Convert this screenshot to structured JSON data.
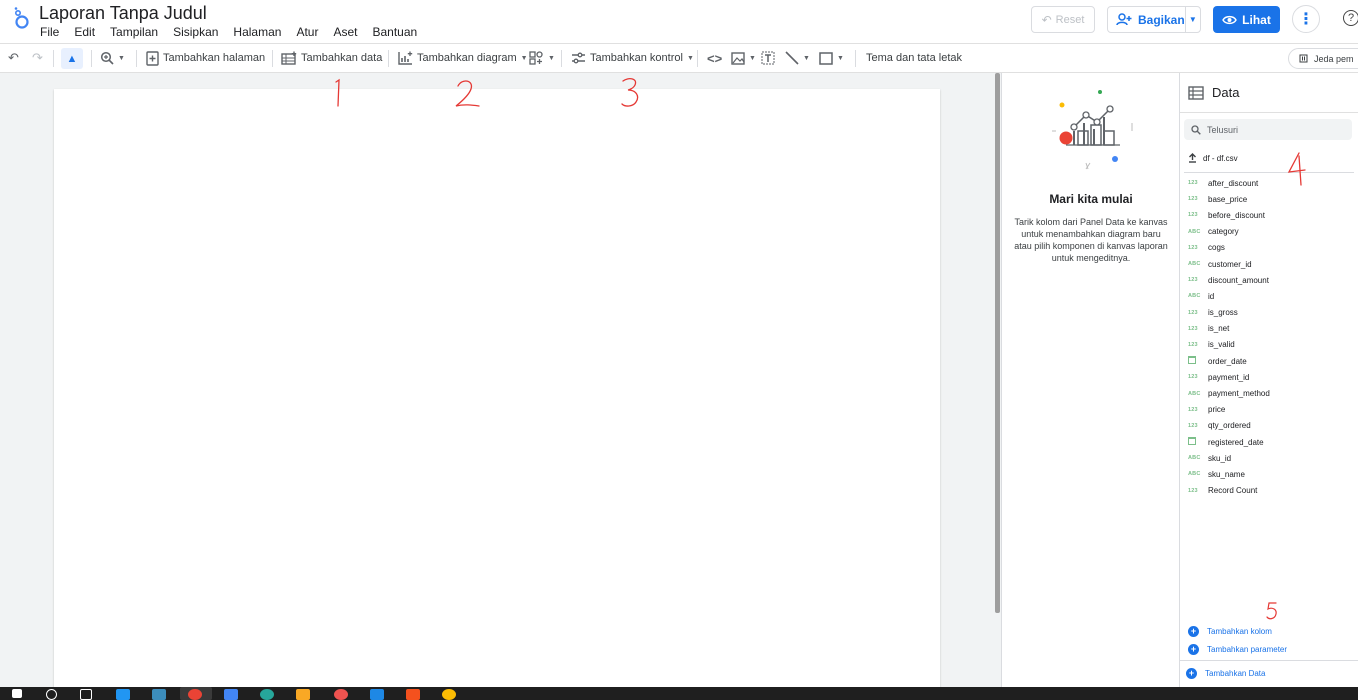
{
  "app": {
    "title": "Laporan Tanpa Judul",
    "menu": [
      "File",
      "Edit",
      "Tampilan",
      "Sisipkan",
      "Halaman",
      "Atur",
      "Aset",
      "Bantuan"
    ]
  },
  "header_buttons": {
    "reset": "Reset",
    "share": "Bagikan",
    "view": "Lihat"
  },
  "toolbar": {
    "add_page": "Tambahkan halaman",
    "add_data": "Tambahkan data",
    "add_chart": "Tambahkan diagram",
    "add_control": "Tambahkan kontrol",
    "theme_layout": "Tema dan tata letak",
    "pause": "Jeda pem"
  },
  "properties_panel": {
    "heading": "Mari kita mulai",
    "body": "Tarik kolom dari Panel Data ke kanvas untuk menambahkan diagram baru atau pilih komponen di kanvas laporan untuk mengeditnya."
  },
  "data_panel": {
    "title": "Data",
    "search_placeholder": "Telusuri",
    "source": "df - df.csv",
    "fields": [
      {
        "type": "123",
        "name": "after_discount"
      },
      {
        "type": "123",
        "name": "base_price"
      },
      {
        "type": "123",
        "name": "before_discount"
      },
      {
        "type": "ABC",
        "name": "category"
      },
      {
        "type": "123",
        "name": "cogs"
      },
      {
        "type": "ABC",
        "name": "customer_id"
      },
      {
        "type": "123",
        "name": "discount_amount"
      },
      {
        "type": "ABC",
        "name": "id"
      },
      {
        "type": "123",
        "name": "is_gross"
      },
      {
        "type": "123",
        "name": "is_net"
      },
      {
        "type": "123",
        "name": "is_valid"
      },
      {
        "type": "date",
        "name": "order_date"
      },
      {
        "type": "123",
        "name": "payment_id"
      },
      {
        "type": "ABC",
        "name": "payment_method"
      },
      {
        "type": "123",
        "name": "price"
      },
      {
        "type": "123",
        "name": "qty_ordered"
      },
      {
        "type": "date",
        "name": "registered_date"
      },
      {
        "type": "ABC",
        "name": "sku_id"
      },
      {
        "type": "ABC",
        "name": "sku_name"
      },
      {
        "type": "123",
        "name": "Record Count"
      }
    ],
    "add_column": "Tambahkan kolom",
    "add_parameter": "Tambahkan parameter",
    "add_data": "Tambahkan Data"
  },
  "annotations": [
    "1",
    "2",
    "3",
    "4",
    "5"
  ],
  "colors": {
    "accent": "#1a73e8",
    "annotation": "#e53935",
    "field_type": "#7cbf8a"
  }
}
